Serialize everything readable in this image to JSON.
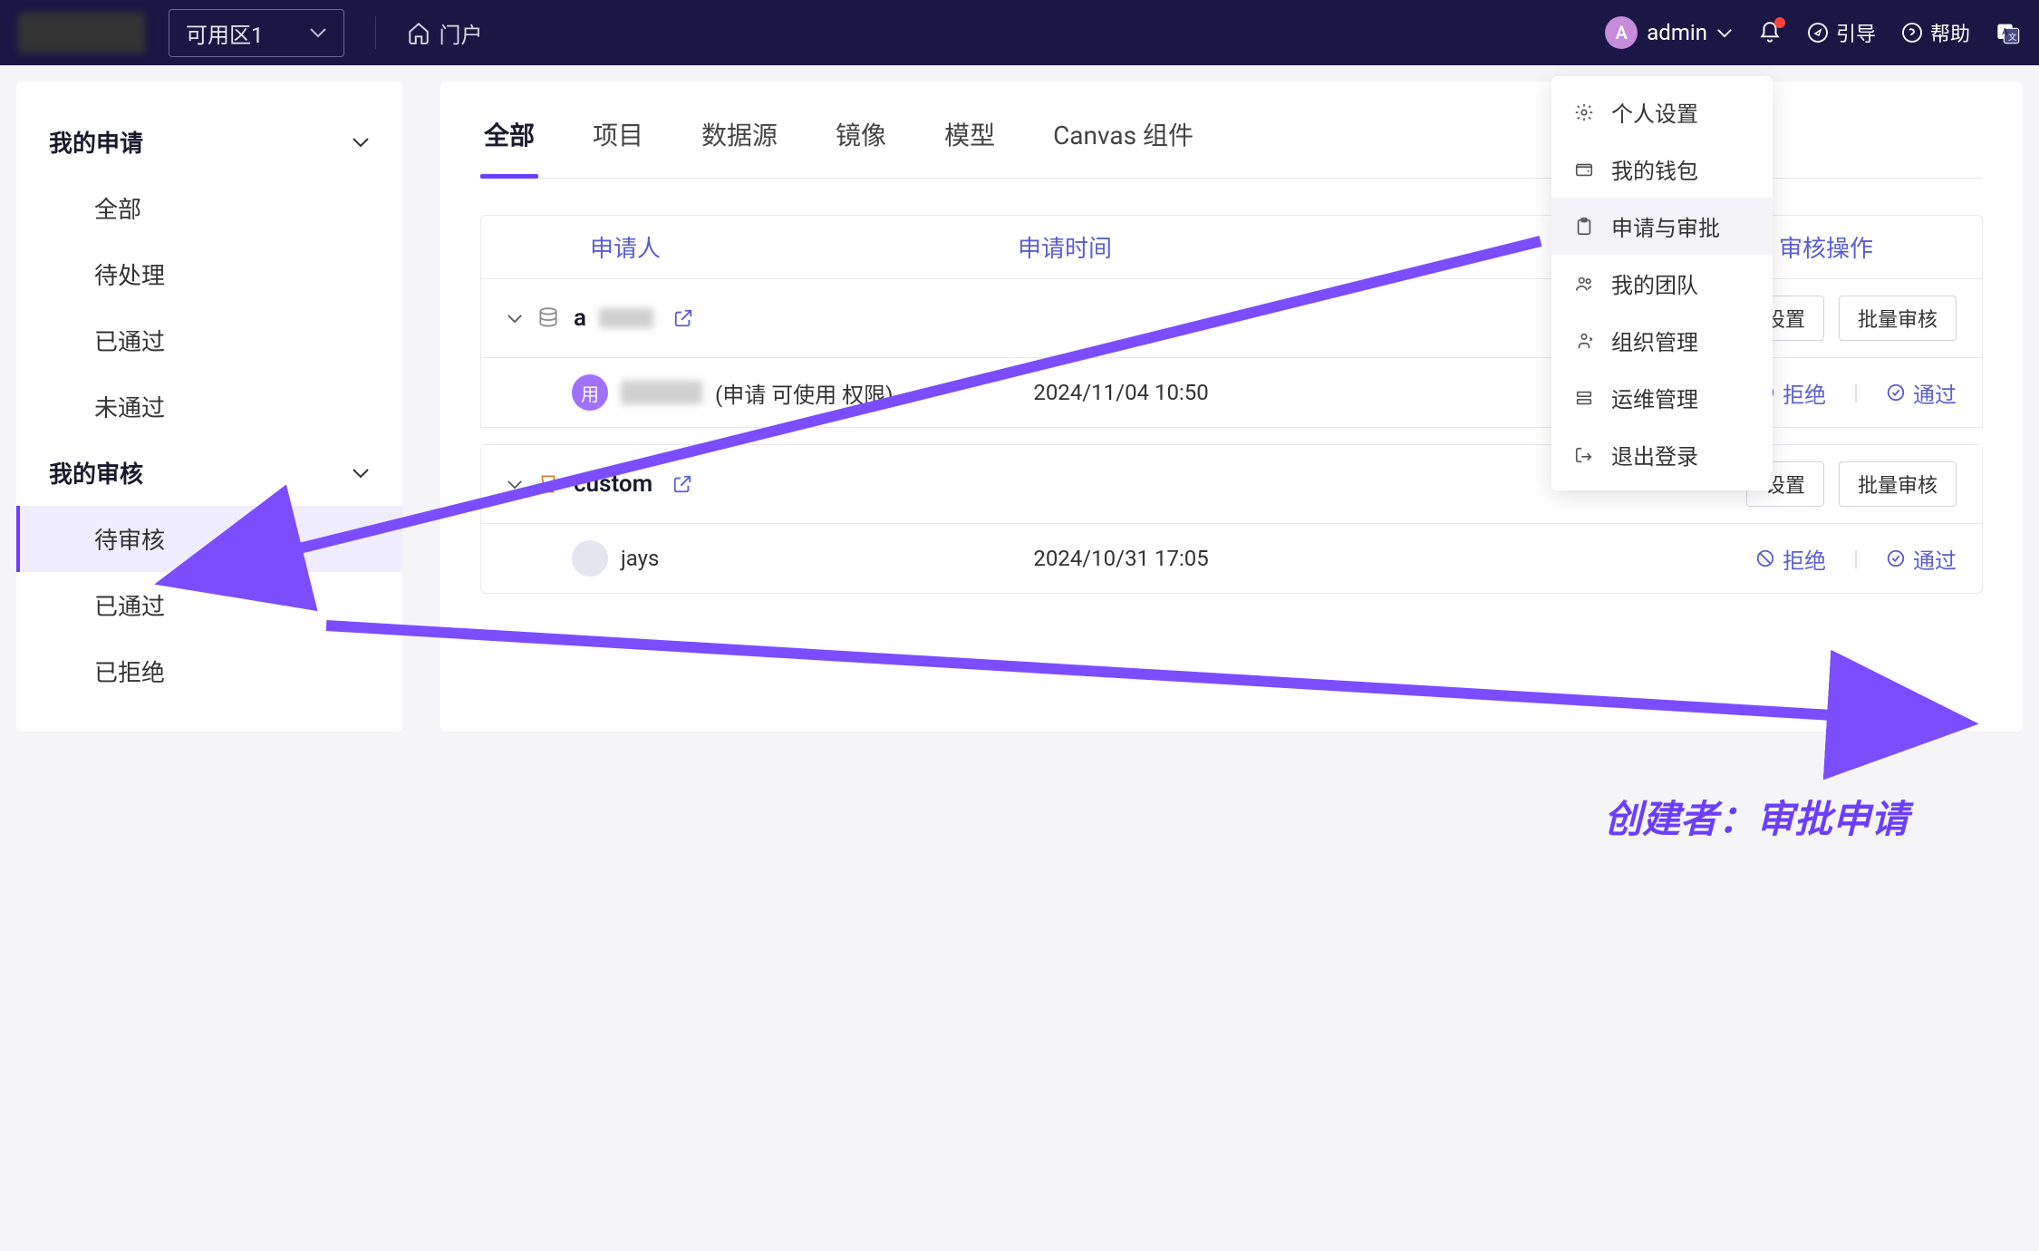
{
  "topbar": {
    "zoneSelect": "可用区1",
    "portal": "门户",
    "user": "admin",
    "avatarLetter": "A",
    "guide": "引导",
    "help": "帮助"
  },
  "dropdown": {
    "items": [
      {
        "icon": "gear",
        "label": "个人设置"
      },
      {
        "icon": "wallet",
        "label": "我的钱包"
      },
      {
        "icon": "clipboard",
        "label": "申请与审批",
        "hover": true
      },
      {
        "icon": "team",
        "label": "我的团队"
      },
      {
        "icon": "org",
        "label": "组织管理"
      },
      {
        "icon": "ops",
        "label": "运维管理"
      },
      {
        "icon": "logout",
        "label": "退出登录"
      }
    ]
  },
  "sidebar": {
    "group1": {
      "title": "我的申请",
      "items": [
        "全部",
        "待处理",
        "已通过",
        "未通过"
      ]
    },
    "group2": {
      "title": "我的审核",
      "items": [
        "待审核",
        "已通过",
        "已拒绝"
      ]
    }
  },
  "tabs": [
    "全部",
    "项目",
    "数据源",
    "镜像",
    "模型",
    "Canvas 组件"
  ],
  "table": {
    "headers": {
      "applicant": "申请人",
      "time": "申请时间",
      "action": "审核操作"
    },
    "settingsBtn": "设置",
    "batchBtn": "批量审核",
    "rejectBtn": "拒绝",
    "approveBtn": "通过"
  },
  "groups": [
    {
      "name": "a",
      "type": "database",
      "rows": [
        {
          "avatar": "用",
          "avatarClass": "avatar-purple",
          "blurred": true,
          "suffix": " (申请 可使用 权限)",
          "time": "2024/11/04 10:50"
        }
      ]
    },
    {
      "name": "custom",
      "type": "cup",
      "rows": [
        {
          "avatar": "",
          "avatarClass": "avatar-light",
          "name": "jays",
          "time": "2024/10/31 17:05"
        }
      ]
    }
  ],
  "annotation": "创建者：审批申请"
}
